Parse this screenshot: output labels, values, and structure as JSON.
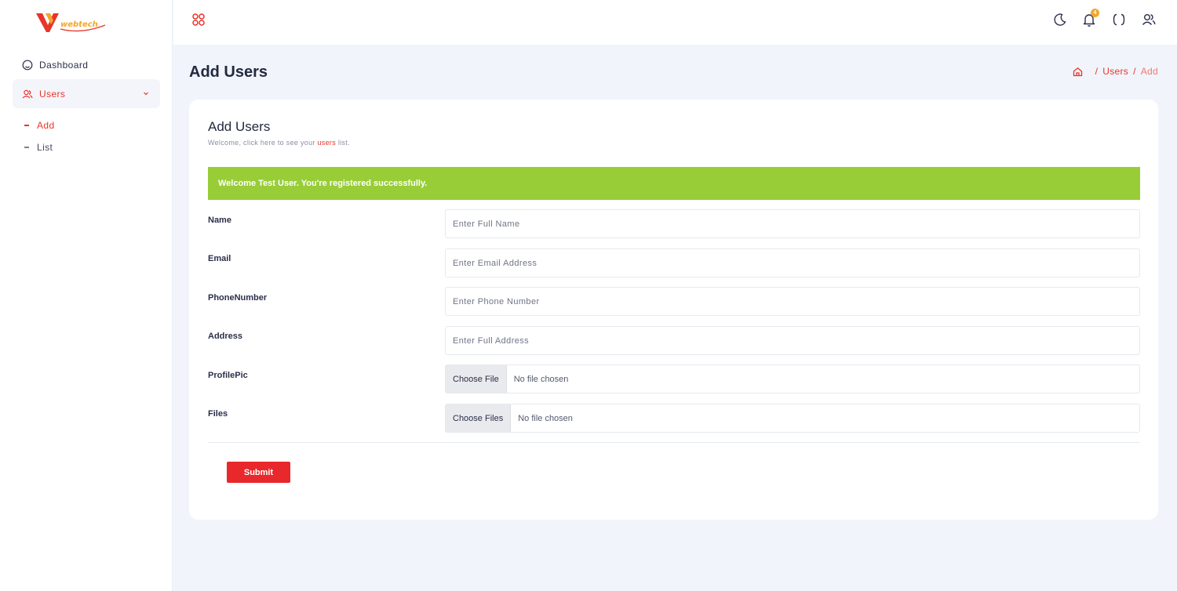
{
  "brand": {
    "logo_text": "WEBTECH",
    "colors": {
      "accent": "#e8352a",
      "success": "#98cd38",
      "badge": "#f3a62b"
    }
  },
  "sidebar": {
    "items": [
      {
        "label": "Dashboard",
        "icon": "home-icon"
      },
      {
        "label": "Users",
        "icon": "users-icon",
        "expanded": true
      }
    ],
    "sub_items": [
      {
        "label": "Add",
        "active": true
      },
      {
        "label": "List",
        "active": false
      }
    ]
  },
  "header": {
    "menu_icon": "apps-grid-icon",
    "icons": [
      "moon-icon",
      "bell-icon",
      "fullscreen-icon",
      "user-icon"
    ],
    "notification_count": "4"
  },
  "page": {
    "title": "Add Users",
    "breadcrumb": {
      "link": "Users",
      "current": "Add"
    }
  },
  "card": {
    "title": "Add Users",
    "subtitle_before": "Welcome, click here to see your",
    "subtitle_link": "users",
    "subtitle_after": "list.",
    "alert": "Welcome Test User. You're registered successfully."
  },
  "form": {
    "name": {
      "label": "Name",
      "placeholder": "Enter Full Name",
      "value": ""
    },
    "email": {
      "label": "Email",
      "placeholder": "Enter Email Address",
      "value": ""
    },
    "phone": {
      "label": "PhoneNumber",
      "placeholder": "Enter Phone Number",
      "value": ""
    },
    "address": {
      "label": "Address",
      "placeholder": "Enter Full Address",
      "value": ""
    },
    "profile_pic": {
      "label": "ProfilePic",
      "button": "Choose File",
      "status": "No file chosen"
    },
    "files": {
      "label": "Files",
      "button": "Choose Files",
      "status": "No file chosen"
    },
    "submit": "Submit"
  }
}
